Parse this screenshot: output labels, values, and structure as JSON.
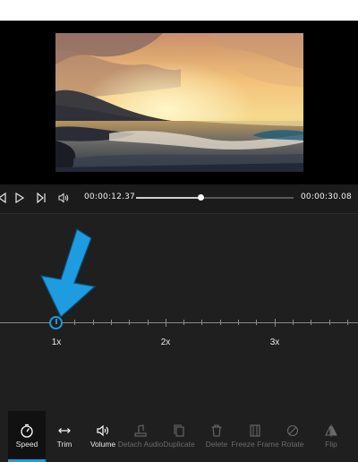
{
  "transport": {
    "current_time": "00:00:12.37",
    "total_time": "00:00:30.08",
    "progress": 0.41,
    "icons": [
      "previous-frame-icon",
      "play-icon",
      "next-frame-icon",
      "volume-icon"
    ]
  },
  "speed": {
    "current": "1x",
    "marks": [
      "1x",
      "2x",
      "3x"
    ]
  },
  "toolbar": {
    "items": [
      {
        "label": "Speed",
        "icon": "speed-icon",
        "enabled": true,
        "active": true
      },
      {
        "label": "Trim",
        "icon": "trim-icon",
        "enabled": true,
        "active": false
      },
      {
        "label": "Volume",
        "icon": "volume-icon",
        "enabled": true,
        "active": false
      },
      {
        "label": "Detach Audio",
        "icon": "detach-audio-icon",
        "enabled": false,
        "active": false
      },
      {
        "label": "Duplicate",
        "icon": "duplicate-icon",
        "enabled": false,
        "active": false
      },
      {
        "label": "Delete",
        "icon": "delete-icon",
        "enabled": false,
        "active": false
      },
      {
        "label": "Freeze Frame",
        "icon": "freeze-frame-icon",
        "enabled": false,
        "active": false
      },
      {
        "label": "Rotate",
        "icon": "rotate-icon",
        "enabled": false,
        "active": false
      },
      {
        "label": "Flip",
        "icon": "flip-icon",
        "enabled": false,
        "active": false
      }
    ]
  },
  "colors": {
    "accent": "#1f9be0",
    "background": "#1f1f1f",
    "disabled_text": "#6b6b6b"
  }
}
